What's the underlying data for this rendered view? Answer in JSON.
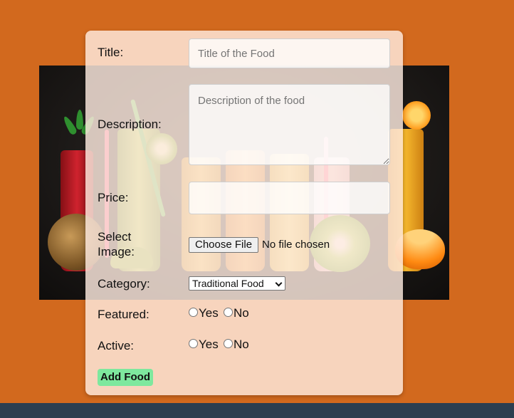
{
  "form": {
    "title_label": "Title:",
    "title_placeholder": "Title of the Food",
    "description_label": "Description:",
    "description_placeholder": "Description of the food",
    "price_label": "Price:",
    "price_value": "",
    "image_label_line1": "Select",
    "image_label_line2": "Image:",
    "file_button_label": "Choose File",
    "file_status": "No file chosen",
    "category_label": "Category:",
    "category_selected": "Traditional Food",
    "featured_label": "Featured:",
    "featured_yes": "Yes",
    "featured_no": "No",
    "active_label": "Active:",
    "active_yes": "Yes",
    "active_no": "No",
    "submit_label": "Add Food"
  },
  "colors": {
    "page_background": "#d2691e",
    "footer": "#2c3e50",
    "submit_button": "#7ee89e",
    "card_background": "#ffebe1"
  },
  "icons": {
    "select_arrow": "chevron-down-icon"
  }
}
